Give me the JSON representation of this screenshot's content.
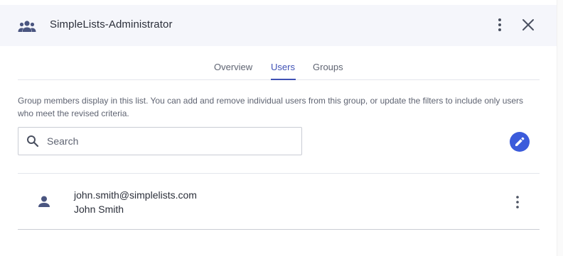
{
  "header": {
    "title": "SimpleLists-Administrator",
    "icon": "group-icon",
    "more_icon": "more-vert-icon",
    "close_icon": "close-icon"
  },
  "tabs": [
    {
      "label": "Overview",
      "active": false
    },
    {
      "label": "Users",
      "active": true
    },
    {
      "label": "Groups",
      "active": false
    }
  ],
  "description": "Group members display in this list. You can add and remove individual users from this group, or update the filters to include only users who meet the revised criteria.",
  "search": {
    "placeholder": "Search",
    "value": ""
  },
  "edit_icon": "pencil-icon",
  "users": [
    {
      "email": "john.smith@simplelists.com",
      "name": "John Smith",
      "icon": "person-icon"
    }
  ],
  "colors": {
    "accent": "#3f51b5",
    "header_bg": "#f5f6fb",
    "icon": "#4a5580",
    "edit_button": "#3b5bdb"
  }
}
